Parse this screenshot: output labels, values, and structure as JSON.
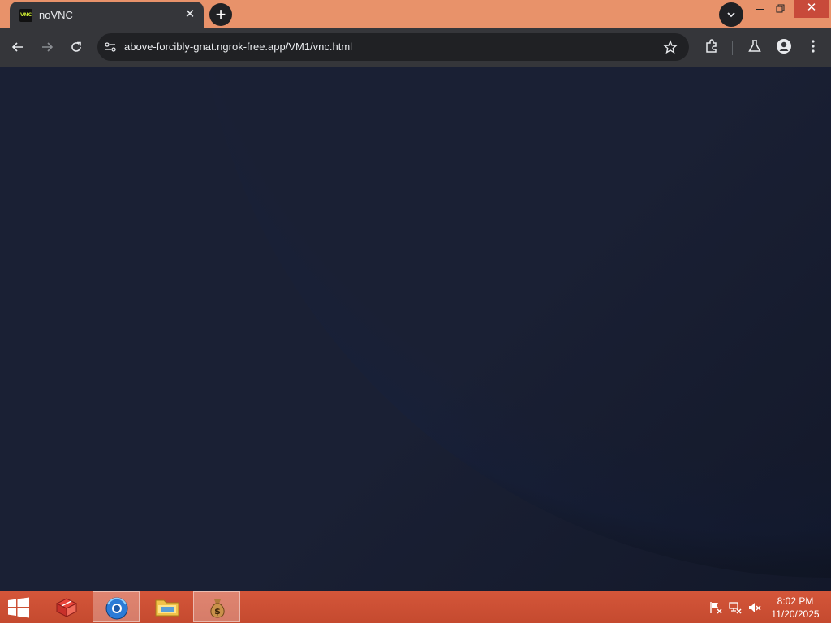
{
  "browser": {
    "tab": {
      "title": "noVNC",
      "favicon_text": "VNC"
    },
    "new_tab_glyph": "+",
    "close_glyph": "✕",
    "url": "above-forcibly-gnat.ngrok-free.app/VM1/vnc.html"
  },
  "taskbar": {
    "apps": [
      {
        "name": "box-icon"
      },
      {
        "name": "browser-icon",
        "active": true
      },
      {
        "name": "file-explorer-icon"
      },
      {
        "name": "money-bag-icon",
        "active": true
      }
    ],
    "clock": {
      "time": "8:02 PM",
      "date": "11/20/2025"
    }
  },
  "colors": {
    "tabstrip": "#e8926a",
    "toolbar": "#35363a",
    "desktop": "#1a2034",
    "taskbar": "#c84a30"
  }
}
